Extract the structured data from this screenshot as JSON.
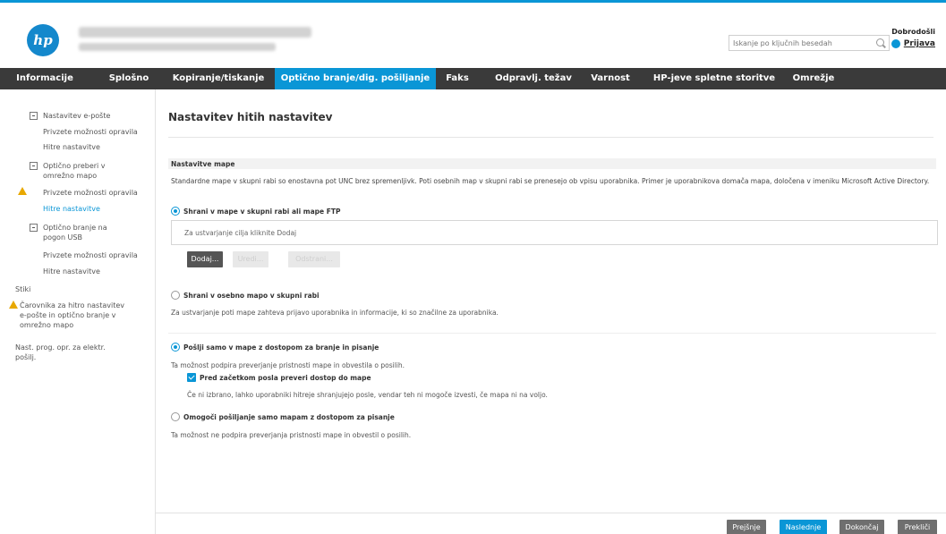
{
  "header": {
    "logo_text": "hp",
    "search_placeholder": "Iskanje po ključnih besedah",
    "welcome": "Dobrodošli",
    "signin": "Prijava"
  },
  "nav": {
    "tabs": [
      {
        "label": "Informacije"
      },
      {
        "label": "Splošno"
      },
      {
        "label": "Kopiranje/tiskanje"
      },
      {
        "label": "Optično branje/dig. pošiljanje"
      },
      {
        "label": "Faks"
      },
      {
        "label": "Odpravlj. težav"
      },
      {
        "label": "Varnost"
      },
      {
        "label": "HP-jeve spletne storitve"
      },
      {
        "label": "Omrežje"
      }
    ],
    "active_index": 3
  },
  "sidebar": {
    "items": [
      {
        "label": "Nastavitev e-pošte"
      },
      {
        "label": "Privzete možnosti opravila"
      },
      {
        "label": "Hitre nastavitve"
      },
      {
        "label": "Optično preberi v omrežno mapo"
      },
      {
        "label": "Privzete možnosti opravila"
      },
      {
        "label": "Hitre nastavitve"
      },
      {
        "label": "Optično branje na pogon USB"
      },
      {
        "label": "Privzete možnosti opravila"
      },
      {
        "label": "Hitre nastavitve"
      },
      {
        "label": "Stiki"
      },
      {
        "label": "Čarovnika za hitro nastavitev e-pošte in optično branje v omrežno mapo"
      },
      {
        "label": "Nast. prog. opr. za elektr. pošilj."
      }
    ]
  },
  "main": {
    "title": "Nastavitev hitih nastavitev",
    "section_title": "Nastavitve mape",
    "description": "Standardne mape v skupni rabi so enostavna pot UNC brez spremenljivk. Poti osebnih map v skupni rabi se prenesejo ob vpisu uporabnika. Primer je uporabnikova domača mapa, določena v imeniku Microsoft Active Directory.",
    "radio_shared": "Shrani v mape v skupni rabi ali mape FTP",
    "dest_placeholder": "Za ustvarjanje cilja kliknite Dodaj",
    "btn_add": "Dodaj...",
    "btn_edit": "Uredi...",
    "btn_remove": "Odstrani...",
    "radio_personal": "Shrani v osebno mapo v skupni rabi",
    "personal_note": "Za ustvarjanje poti mape zahteva prijavo uporabnika in informacije, ki so značilne za uporabnika.",
    "radio_rw": "Pošlji samo v mape z dostopom za branje in pisanje",
    "rw_note": "Ta možnost podpira preverjanje pristnosti mape in obvestila o posilih.",
    "checkbox_label": "Pred začetkom posla preveri dostop do mape",
    "checkbox_note": "Če ni izbrano, lahko uporabniki hitreje shranjujejo posle, vendar teh ni mogoče izvesti, če mapa ni na voljo.",
    "radio_w": "Omogoči pošiljanje samo mapam z dostopom za pisanje",
    "w_note": "Ta možnost ne podpira preverjanja pristnosti mape in obvestil o posilih."
  },
  "footer": {
    "back": "Prejšnje",
    "next": "Naslednje",
    "finish": "Dokončaj",
    "cancel": "Prekliči"
  },
  "colors": {
    "accent": "#0a96d6",
    "nav_bg": "#3a3a3a",
    "warning": "#e8a800"
  }
}
